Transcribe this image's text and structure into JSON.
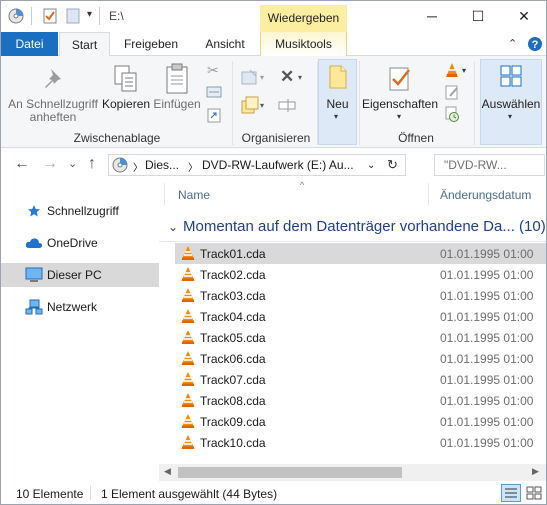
{
  "title_bar": {
    "path": "E:\\",
    "context_tab_group": "Wiedergeben",
    "window_buttons": {
      "minimize": "─",
      "maximize": "☐",
      "close": "✕"
    }
  },
  "ribbon_tabs": [
    "Datei",
    "Start",
    "Freigeben",
    "Ansicht",
    "Musiktools"
  ],
  "ribbon": {
    "pin_label": "An Schnellzugriff anheften",
    "copy_label": "Kopieren",
    "paste_label": "Einfügen",
    "clipboard_group": "Zwischenablage",
    "organize_group": "Organisieren",
    "new_label": "Neu",
    "properties_label": "Eigenschaften",
    "open_group": "Öffnen",
    "select_label": "Auswählen"
  },
  "address_bar": {
    "back": "←",
    "forward": "→",
    "recent": "⌄",
    "up": "↑",
    "crumbs": [
      "Dies...",
      "DVD-RW-Laufwerk (E:) Au..."
    ],
    "search_placeholder": "\"DVD-RW..."
  },
  "nav_pane": [
    {
      "label": "Schnellzugriff",
      "icon": "star-icon"
    },
    {
      "label": "OneDrive",
      "icon": "cloud-icon"
    },
    {
      "label": "Dieser PC",
      "icon": "computer-icon",
      "selected": true
    },
    {
      "label": "Netzwerk",
      "icon": "network-icon"
    }
  ],
  "columns": {
    "name": "Name",
    "date": "Änderungsdatum"
  },
  "group_header": "Momentan auf dem Datenträger vorhandene Da... (10)",
  "files": [
    {
      "name": "Track01.cda",
      "date": "01.01.1995 01:00"
    },
    {
      "name": "Track02.cda",
      "date": "01.01.1995 01:00"
    },
    {
      "name": "Track03.cda",
      "date": "01.01.1995 01:00"
    },
    {
      "name": "Track04.cda",
      "date": "01.01.1995 01:00"
    },
    {
      "name": "Track05.cda",
      "date": "01.01.1995 01:00"
    },
    {
      "name": "Track06.cda",
      "date": "01.01.1995 01:00"
    },
    {
      "name": "Track07.cda",
      "date": "01.01.1995 01:00"
    },
    {
      "name": "Track08.cda",
      "date": "01.01.1995 01:00"
    },
    {
      "name": "Track09.cda",
      "date": "01.01.1995 01:00"
    },
    {
      "name": "Track10.cda",
      "date": "01.01.1995 01:00"
    }
  ],
  "status": {
    "count": "10 Elemente",
    "selection": "1 Element ausgewählt (44 Bytes)"
  },
  "colors": {
    "file_tab": "#1a6fc0",
    "context_tab": "#fbeea0",
    "group_header": "#1e3f8f",
    "selection": "#d9d9d9"
  }
}
